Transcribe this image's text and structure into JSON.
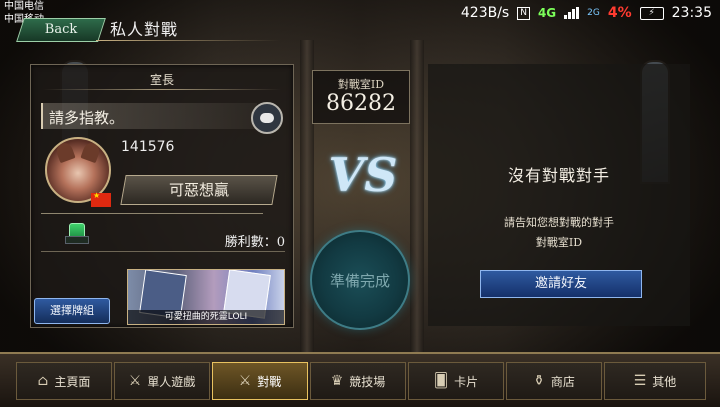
{
  "status_bar": {
    "carrier1": "中国电信",
    "carrier2": "中国移动",
    "speed": "423B/s",
    "nfc": "N",
    "net4g": "4G",
    "net2g": "2G",
    "battery_pct": "4%",
    "time": "23:35"
  },
  "header": {
    "back_label": "Back",
    "title": "私人對戰"
  },
  "host_panel": {
    "title": "室長",
    "greeting": "請多指教。",
    "player_id": "141576",
    "nickname": "可惡想贏",
    "wins": "勝利數：0",
    "deck_name": "可愛扭曲的死靈LOLI",
    "choose_deck": "選擇牌組"
  },
  "room": {
    "label": "對戰室ID",
    "id": "86282"
  },
  "vs_text": "VS",
  "ready_label": "準備完成",
  "opponent_panel": {
    "title": "沒有對戰對手",
    "hint_line1": "請告知您想對戰的對手",
    "hint_line2": "對戰室ID",
    "invite": "邀請好友"
  },
  "nav": [
    {
      "label": "主頁面",
      "icon": "home-icon",
      "glyph": "⌂"
    },
    {
      "label": "單人遊戲",
      "icon": "sword-icon",
      "glyph": "⚔"
    },
    {
      "label": "對戰",
      "icon": "crossed-swords-icon",
      "glyph": "⚔"
    },
    {
      "label": "競技場",
      "icon": "arena-icon",
      "glyph": "♛"
    },
    {
      "label": "卡片",
      "icon": "cards-icon",
      "glyph": "🂠"
    },
    {
      "label": "商店",
      "icon": "shop-icon",
      "glyph": "⚱"
    },
    {
      "label": "其他",
      "icon": "other-icon",
      "glyph": "☰"
    }
  ]
}
